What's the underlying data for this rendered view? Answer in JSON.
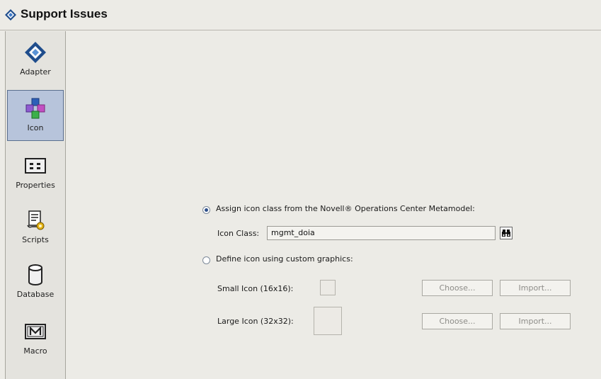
{
  "window": {
    "title": "Support Issues",
    "title_icon": "diamond-arrow-icon"
  },
  "sidebar": {
    "items": [
      {
        "label": "Adapter",
        "icon": "adapter-icon",
        "selected": false
      },
      {
        "label": "Icon",
        "icon": "icon-class-icon",
        "selected": true
      },
      {
        "label": "Properties",
        "icon": "properties-icon",
        "selected": false
      },
      {
        "label": "Scripts",
        "icon": "scripts-icon",
        "selected": false
      },
      {
        "label": "Database",
        "icon": "database-icon",
        "selected": false
      },
      {
        "label": "Macro",
        "icon": "macro-icon",
        "selected": false
      }
    ]
  },
  "icon_panel": {
    "option_metamodel": {
      "label": "Assign icon class from the Novell® Operations Center Metamodel:",
      "checked": true
    },
    "icon_class": {
      "label": "Icon Class:",
      "value": "mgmt_doia",
      "find_icon": "binoculars-icon"
    },
    "option_custom": {
      "label": "Define icon using custom graphics:",
      "checked": false
    },
    "small_icon": {
      "label": "Small Icon (16x16):",
      "choose": "Choose...",
      "import": "Import..."
    },
    "large_icon": {
      "label": "Large Icon (32x32):",
      "choose": "Choose...",
      "import": "Import..."
    }
  }
}
